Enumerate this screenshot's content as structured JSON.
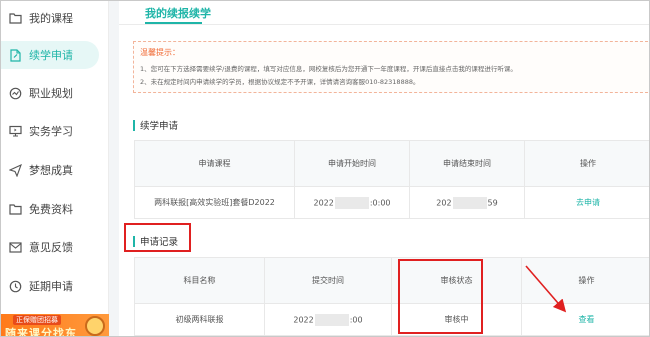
{
  "sidebar": {
    "items": [
      {
        "label": "我的课程",
        "icon": "folder-icon",
        "active": false
      },
      {
        "label": "续学申请",
        "icon": "edit-document-icon",
        "active": true
      },
      {
        "label": "职业规划",
        "icon": "compass-icon",
        "active": false
      },
      {
        "label": "实务学习",
        "icon": "monitor-icon",
        "active": false
      },
      {
        "label": "梦想成真",
        "icon": "send-icon",
        "active": false
      },
      {
        "label": "免费资料",
        "icon": "folder-icon",
        "active": false
      },
      {
        "label": "意见反馈",
        "icon": "mail-icon",
        "active": false
      },
      {
        "label": "延期申请",
        "icon": "clock-icon",
        "active": false
      }
    ],
    "promo": {
      "tag": "正保赠团招募",
      "text": "随来课分找东"
    }
  },
  "main": {
    "title": "我的续报续学",
    "tips": {
      "title": "温馨提示：",
      "lines": [
        "1、您可在下方选择需要续学/退费的课程，填写对应信息，网校复核后为您开通下一年度课程，开课后直接点击我的课程进行听课。",
        "2、未在规定时间内申请续学的学员，根据协议规定不予开课，详情请咨询客服010-82318888。"
      ]
    },
    "apply_section": {
      "title": "续学申请",
      "headers": [
        "申请课程",
        "申请开始时间",
        "申请结束时间",
        "操作"
      ],
      "row": {
        "course": "两科联报[高效实验班]套餐D2022",
        "start_prefix": "2022",
        "start_suffix": ":0:00",
        "end_prefix": "202",
        "end_suffix": "59",
        "action": "去申请"
      }
    },
    "record_section": {
      "title": "申请记录",
      "headers": [
        "科目名称",
        "提交时间",
        "审核状态",
        "操作"
      ],
      "row": {
        "course": "初级两科联报",
        "time_prefix": "2022",
        "time_suffix": ":00",
        "status": "审核中",
        "action": "查看"
      }
    }
  },
  "colors": {
    "accent": "#1fb5a8",
    "annotation": "#e02020",
    "tip": "#f06a35"
  }
}
